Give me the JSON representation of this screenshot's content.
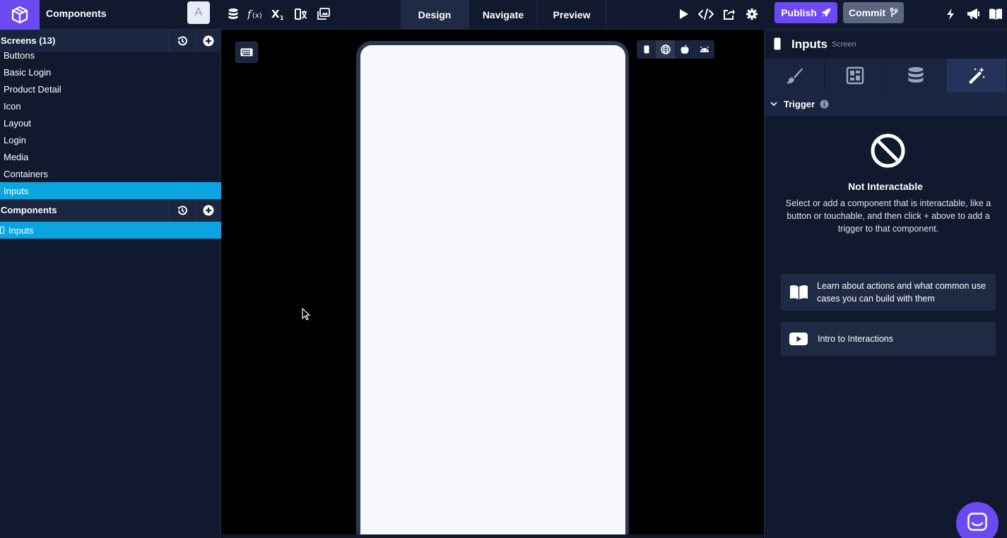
{
  "topbar": {
    "project_name": "Components",
    "avatar_letter": "A",
    "tools": [
      "database-icon",
      "function-icon",
      "subscript-icon",
      "translate-icon",
      "image-gallery-icon"
    ],
    "modes": [
      "Design",
      "Navigate",
      "Preview"
    ],
    "active_mode": "Design",
    "publish_label": "Publish",
    "commit_label": "Commit"
  },
  "sidebar": {
    "screens_title": "Screens (13)",
    "screens": [
      "Buttons",
      "Basic Login",
      "Product Detail",
      "Icon",
      "Layout",
      "Login",
      "Media",
      "Containers",
      "Inputs"
    ],
    "active_screen": "Inputs",
    "components_title": "Components",
    "components": [
      "Inputs"
    ]
  },
  "right_panel": {
    "title": "Inputs",
    "subtitle": "Screen",
    "tabs": [
      "style-brush-icon",
      "layout-icon",
      "data-icon",
      "interactions-wand-icon"
    ],
    "active_tab": "interactions-wand-icon",
    "trigger_label": "Trigger",
    "not_interactable_title": "Not Interactable",
    "not_interactable_desc": "Select or add a component that is interactable, like a button or touchable, and then click + above to add a trigger to that component.",
    "learn_card": "Learn about actions and what common use cases you can build with them",
    "video_card": "Intro to Interactions"
  },
  "colors": {
    "brand": "#6c4af2",
    "selection": "#0aa5e1",
    "panel_bg": "#11192e"
  }
}
